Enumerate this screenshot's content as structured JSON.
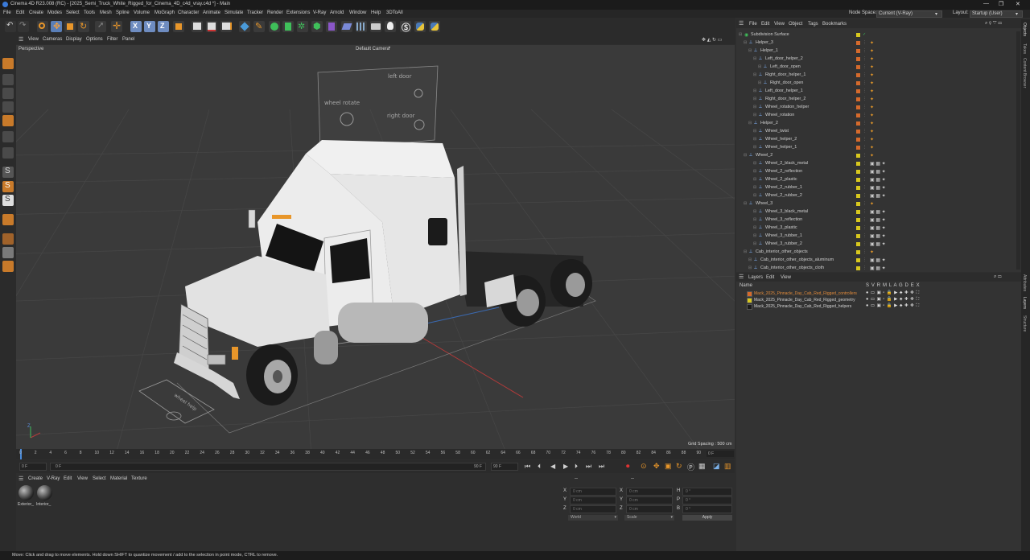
{
  "title_bar": {
    "title": "Cinema 4D R23.008 (RC) - [2025_Semi_Truck_White_Rigged_for_Cinema_4D_c4d_vray.c4d *] - Main",
    "minimize": "—",
    "maximize": "❐",
    "close": "✕"
  },
  "menu": [
    "File",
    "Edit",
    "Create",
    "Modes",
    "Select",
    "Tools",
    "Mesh",
    "Spline",
    "Volume",
    "MoGraph",
    "Character",
    "Animate",
    "Simulate",
    "Tracker",
    "Render",
    "Extensions",
    "V-Ray",
    "Arnold",
    "Window",
    "Help",
    "3DToAll"
  ],
  "node_space": {
    "label": "Node Space:",
    "value": "Current (V-Ray)"
  },
  "layout": {
    "label": "Layout:",
    "value": "Startup (User)"
  },
  "viewport": {
    "menu": [
      "View",
      "Cameras",
      "Display",
      "Options",
      "Filter",
      "Panel"
    ],
    "name": "Perspective",
    "camera": "Default Camera",
    "camera_icon": "•",
    "grid_spacing": "Grid Spacing : 500 cm",
    "sign_labels": {
      "left_door": "left door",
      "wheel_rotate": "wheel rotate",
      "right_door": "right door",
      "wheel_helper": "wheel help"
    },
    "axis_label": "Z"
  },
  "timeline": {
    "ticks": [
      "0",
      "2",
      "4",
      "6",
      "8",
      "10",
      "12",
      "14",
      "16",
      "18",
      "20",
      "22",
      "24",
      "26",
      "28",
      "30",
      "32",
      "34",
      "36",
      "38",
      "40",
      "42",
      "44",
      "46",
      "48",
      "50",
      "52",
      "54",
      "56",
      "58",
      "60",
      "62",
      "64",
      "66",
      "68",
      "70",
      "72",
      "74",
      "76",
      "78",
      "80",
      "82",
      "84",
      "86",
      "88",
      "90"
    ],
    "frame_display": "0 F"
  },
  "transport": {
    "current": "0 F",
    "start": "0 F",
    "end": "90 F",
    "end2": "90 F"
  },
  "material_manager": {
    "menu": [
      "Create",
      "V-Ray",
      "Edit",
      "View",
      "Select",
      "Material",
      "Texture"
    ],
    "materials": [
      "Exterior_",
      "Interior_"
    ]
  },
  "coordinates": {
    "header": "--",
    "header2": "--",
    "rows": [
      {
        "axis": "X",
        "pos": "0 cm",
        "size_axis": "X",
        "size": "0 cm",
        "rot_axis": "H",
        "rot": "0 °"
      },
      {
        "axis": "Y",
        "pos": "0 cm",
        "size_axis": "Y",
        "size": "0 cm",
        "rot_axis": "P",
        "rot": "0 °"
      },
      {
        "axis": "Z",
        "pos": "0 cm",
        "size_axis": "Z",
        "size": "0 cm",
        "rot_axis": "B",
        "rot": "0 °"
      }
    ],
    "mode": "World",
    "scale_mode": "Scale",
    "apply": "Apply"
  },
  "objects_panel": {
    "menu": [
      "File",
      "Edit",
      "View",
      "Object",
      "Tags",
      "Bookmarks"
    ],
    "items": [
      {
        "name": "Subdivision Surface",
        "indent": 0,
        "color": "#d8c81e"
      },
      {
        "name": "Helper_3",
        "indent": 1,
        "color": "#d56a2c"
      },
      {
        "name": "Helper_1",
        "indent": 2,
        "color": "#d56a2c"
      },
      {
        "name": "Left_door_helper_2",
        "indent": 3,
        "color": "#d56a2c"
      },
      {
        "name": "Left_door_open",
        "indent": 4,
        "color": "#d56a2c"
      },
      {
        "name": "Right_door_helper_1",
        "indent": 3,
        "color": "#d56a2c"
      },
      {
        "name": "Right_door_open",
        "indent": 4,
        "color": "#d56a2c"
      },
      {
        "name": "Left_door_helper_1",
        "indent": 3,
        "color": "#d56a2c"
      },
      {
        "name": "Right_door_helper_2",
        "indent": 3,
        "color": "#d56a2c"
      },
      {
        "name": "Wheel_rotation_helper",
        "indent": 3,
        "color": "#d56a2c"
      },
      {
        "name": "Wheel_rotation",
        "indent": 3,
        "color": "#d56a2c"
      },
      {
        "name": "Helper_2",
        "indent": 2,
        "color": "#d56a2c"
      },
      {
        "name": "Wheel_twist",
        "indent": 3,
        "color": "#d56a2c"
      },
      {
        "name": "Wheel_helper_2",
        "indent": 3,
        "color": "#d56a2c"
      },
      {
        "name": "Wheel_helper_1",
        "indent": 3,
        "color": "#d56a2c"
      },
      {
        "name": "Wheel_2",
        "indent": 1,
        "color": "#d8c81e"
      },
      {
        "name": "Wheel_2_black_metal",
        "indent": 3,
        "color": "#d8c81e"
      },
      {
        "name": "Wheel_2_reflection",
        "indent": 3,
        "color": "#d8c81e"
      },
      {
        "name": "Wheel_2_plastic",
        "indent": 3,
        "color": "#d8c81e"
      },
      {
        "name": "Wheel_2_rubber_1",
        "indent": 3,
        "color": "#d8c81e"
      },
      {
        "name": "Wheel_2_rubber_2",
        "indent": 3,
        "color": "#d8c81e"
      },
      {
        "name": "Wheel_3",
        "indent": 1,
        "color": "#d8c81e"
      },
      {
        "name": "Wheel_3_black_metal",
        "indent": 3,
        "color": "#d8c81e"
      },
      {
        "name": "Wheel_3_reflection",
        "indent": 3,
        "color": "#d8c81e"
      },
      {
        "name": "Wheel_3_plastic",
        "indent": 3,
        "color": "#d8c81e"
      },
      {
        "name": "Wheel_3_rubber_1",
        "indent": 3,
        "color": "#d8c81e"
      },
      {
        "name": "Wheel_3_rubber_2",
        "indent": 3,
        "color": "#d8c81e"
      },
      {
        "name": "Cab_interior_other_objects",
        "indent": 1,
        "color": "#d8c81e"
      },
      {
        "name": "Cab_interior_other_objects_aluminum",
        "indent": 2,
        "color": "#d8c81e"
      },
      {
        "name": "Cab_interior_other_objects_cloth",
        "indent": 2,
        "color": "#d8c81e"
      }
    ]
  },
  "layers_panel": {
    "menu": [
      "Layers",
      "Edit",
      "View"
    ],
    "name_header": "Name",
    "column_header": "S V R M L A G D E X",
    "layers": [
      {
        "name": "Mack_2025_Pinnacle_Day_Cab_Red_Rigged_controllers",
        "color": "#d56a2c",
        "name_color": "#e08a3a"
      },
      {
        "name": "Mack_2025_Pinnacle_Day_Cab_Red_Rigged_geometry",
        "color": "#d8c81e",
        "name_color": "#d0d0d0"
      },
      {
        "name": "Mack_2025_Pinnacle_Day_Cab_Red_Rigged_helpers",
        "color": "#1a1a1a",
        "name_color": "#d0d0d0"
      }
    ]
  },
  "right_tabs": [
    "Objects",
    "Takes",
    "Content Browser",
    "Attributes",
    "Layers",
    "Structure"
  ],
  "status_bar": "Move: Click and drag to move elements. Hold down SHIFT to quantize movement / add to the selection in point mode, CTRL to remove."
}
